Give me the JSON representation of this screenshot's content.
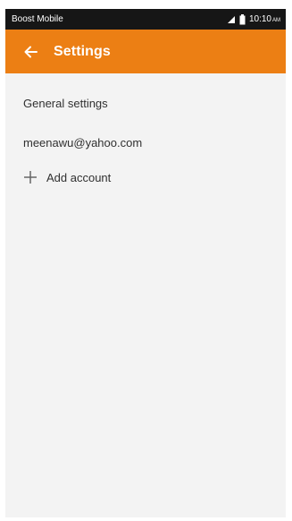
{
  "status_bar": {
    "carrier": "Boost Mobile",
    "time": "10:10",
    "ampm": "AM",
    "icons": [
      "signal-icon",
      "battery-icon"
    ]
  },
  "app_bar": {
    "title": "Settings",
    "back_icon": "arrow-left-icon"
  },
  "items": {
    "general": "General settings",
    "account": "meenawu@yahoo.com",
    "add": "Add account",
    "add_icon": "plus-icon"
  },
  "colors": {
    "status_bar": "#161616",
    "app_bar": "#ec7f14",
    "background": "#f3f3f3"
  }
}
